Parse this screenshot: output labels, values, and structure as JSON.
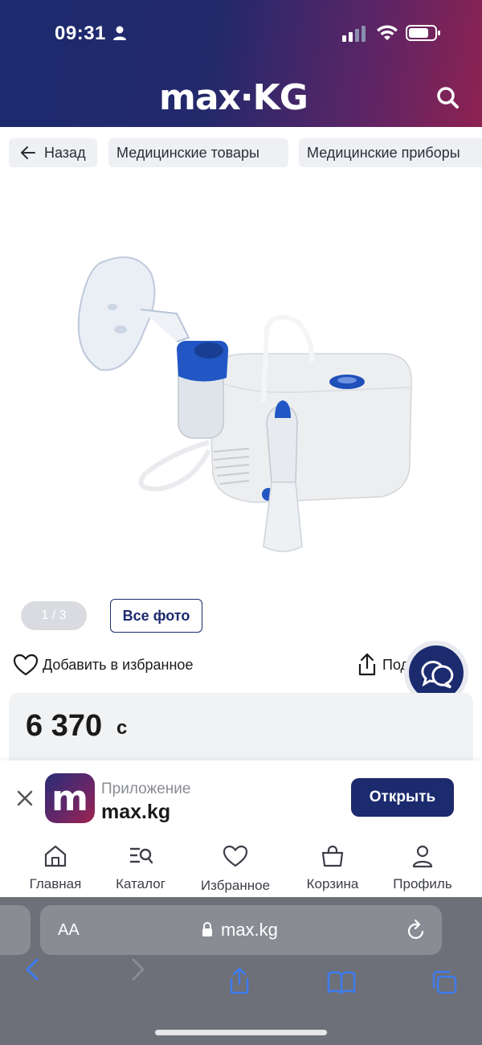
{
  "status": {
    "time": "09:31"
  },
  "header": {
    "logo": "max·KG"
  },
  "breadcrumbs": {
    "back": "Назад",
    "items": [
      "Медицинские товары",
      "Медицинские приборы"
    ]
  },
  "gallery": {
    "counter": "1 / 3",
    "all_photos": "Все фото"
  },
  "actions": {
    "favorite": "Добавить в избранное",
    "share": "Поделиться"
  },
  "price": {
    "value": "6 370",
    "currency": "с"
  },
  "app_banner": {
    "title": "Приложение",
    "name": "max.kg",
    "open": "Открыть",
    "icon_letter": "m"
  },
  "bottom_nav": {
    "items": [
      {
        "label": "Главная",
        "icon": "home-icon"
      },
      {
        "label": "Каталог",
        "icon": "catalog-icon"
      },
      {
        "label": "Избранное",
        "icon": "heart-icon"
      },
      {
        "label": "Корзина",
        "icon": "basket-icon"
      },
      {
        "label": "Профиль",
        "icon": "profile-icon"
      }
    ]
  },
  "browser": {
    "aa": "AA",
    "url": "max.kg"
  },
  "colors": {
    "brand_navy": "#1c2a6e",
    "brand_magenta": "#8e2251"
  }
}
